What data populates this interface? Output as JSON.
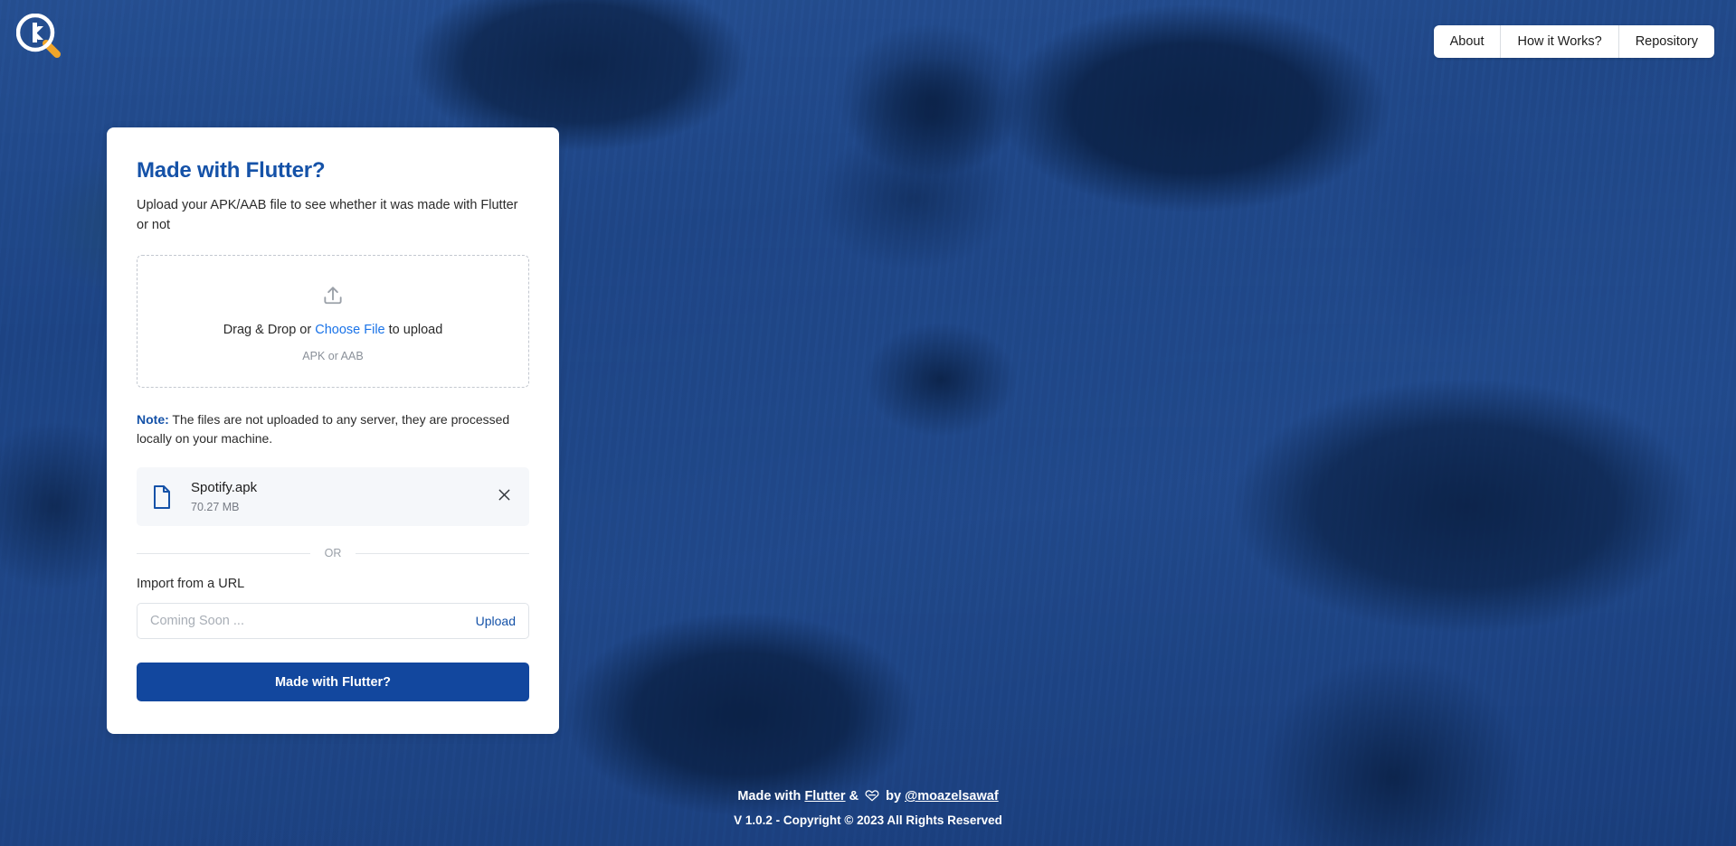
{
  "nav": {
    "items": [
      {
        "label": "About",
        "name": "nav-item-about"
      },
      {
        "label": "How it Works?",
        "name": "nav-item-how-it-works"
      },
      {
        "label": "Repository",
        "name": "nav-item-repository"
      }
    ]
  },
  "logo": {
    "icon": "magnifier-flutter-logo-icon"
  },
  "card": {
    "title": "Made with Flutter?",
    "subtitle": "Upload your APK/AAB file to see whether it was made with Flutter or not",
    "dropzone": {
      "icon": "upload-icon",
      "text_before": "Drag & Drop or ",
      "link": "Choose File",
      "text_after": " to upload",
      "hint": "APK or AAB"
    },
    "note": {
      "label": "Note:",
      "text": " The files are not uploaded to any server, they are processed locally on your machine."
    },
    "file": {
      "icon": "document-icon",
      "name": "Spotify.apk",
      "size": "70.27 MB",
      "remove_icon": "close-icon"
    },
    "divider_text": "OR",
    "import_label": "Import from a URL",
    "url_field": {
      "value": "",
      "placeholder": "Coming Soon ...",
      "upload_label": "Upload"
    },
    "submit_label": "Made with Flutter?"
  },
  "footer": {
    "made_with": "Made with ",
    "flutter_link": "Flutter",
    "amp": " & ",
    "heart": "ᾐD",
    "by": " by ",
    "author_link": "@moazelsawaf",
    "copyright": "V 1.0.2 - Copyright © 2023 All Rights Reserved"
  },
  "colors": {
    "brand_blue": "#12479e",
    "title_blue": "#1552a8",
    "link_blue": "#1a73e8",
    "overlay_blue": "#154da1"
  }
}
